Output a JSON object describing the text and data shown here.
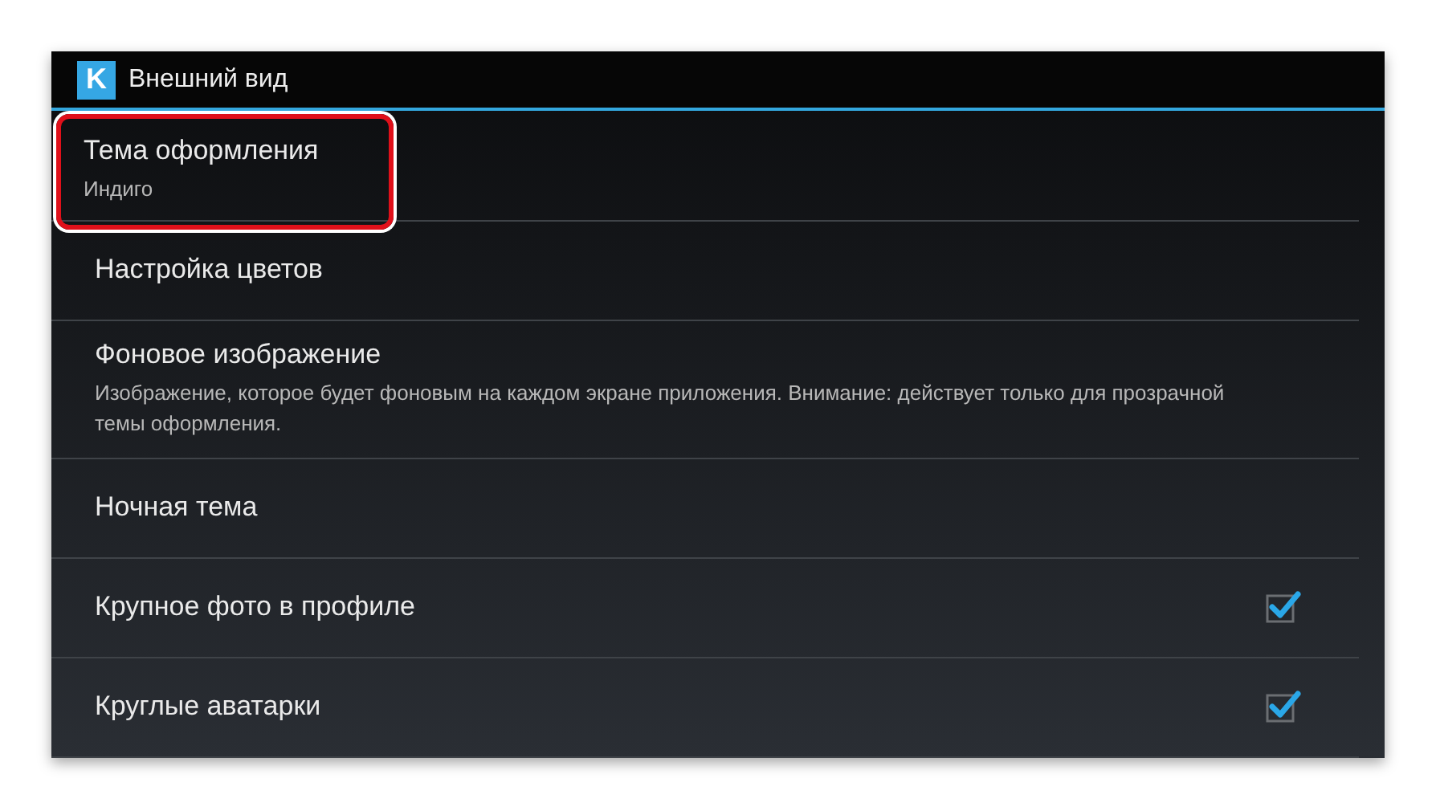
{
  "header": {
    "logo": "K",
    "title": "Внешний вид"
  },
  "items": [
    {
      "kind": "text",
      "title": "Тема оформления",
      "summary": "Индиго",
      "highlighted": true
    },
    {
      "kind": "text",
      "title": "Настройка цветов",
      "highlighted": false
    },
    {
      "kind": "text",
      "title": "Фоновое изображение",
      "summary": "Изображение, которое будет фоновым на каждом экране приложения. Внимание: действует только для прозрачной темы оформления.",
      "highlighted": false
    },
    {
      "kind": "text",
      "title": "Ночная тема",
      "highlighted": false
    },
    {
      "kind": "checkbox",
      "title": "Крупное фото в профиле",
      "checked": true,
      "highlighted": false
    },
    {
      "kind": "checkbox",
      "title": "Круглые аватарки",
      "checked": true,
      "highlighted": false
    }
  ]
}
